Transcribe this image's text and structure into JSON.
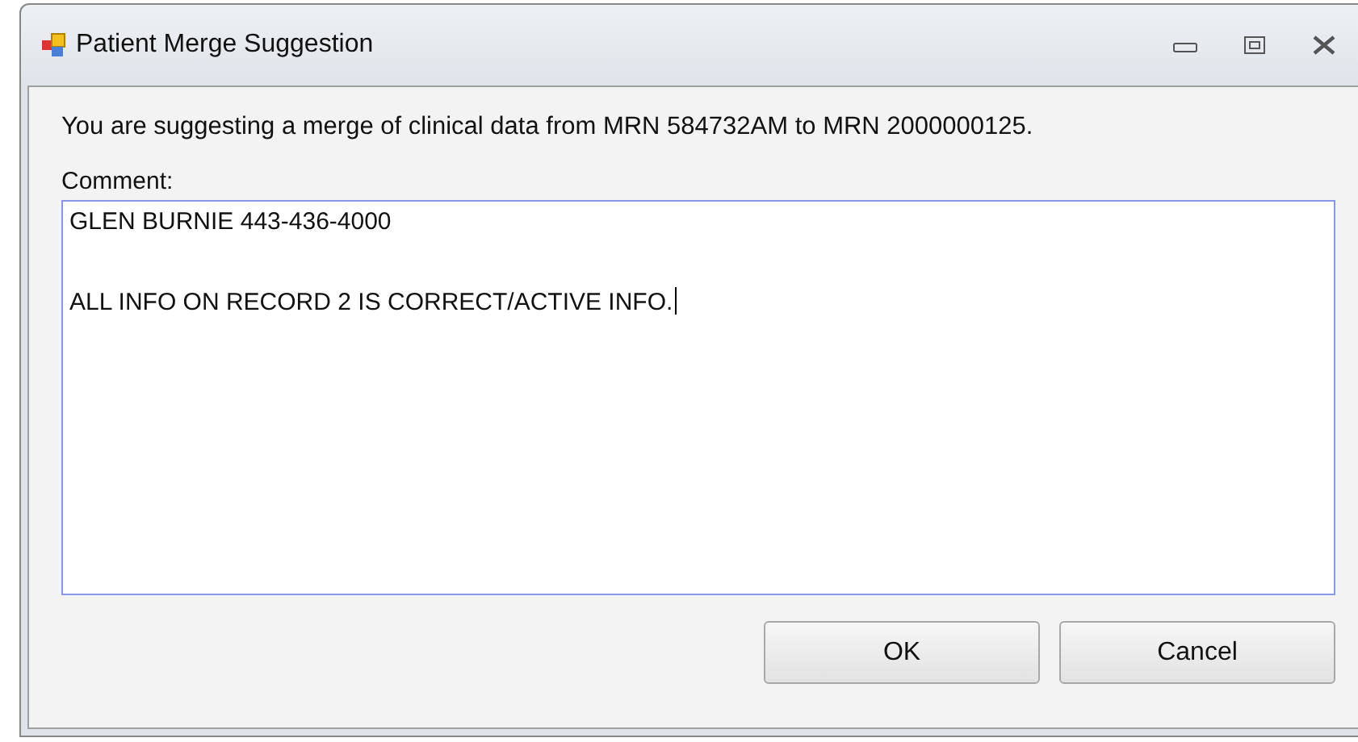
{
  "window": {
    "title": "Patient Merge Suggestion"
  },
  "message": "You are suggesting a merge of clinical data from MRN 584732AM to MRN 2000000125.",
  "comment": {
    "label": "Comment:",
    "lines": [
      "GLEN BURNIE 443-436-4000",
      "ALL INFO ON RECORD 2 IS CORRECT/ACTIVE INFO."
    ]
  },
  "buttons": [
    "OK",
    "Cancel"
  ]
}
